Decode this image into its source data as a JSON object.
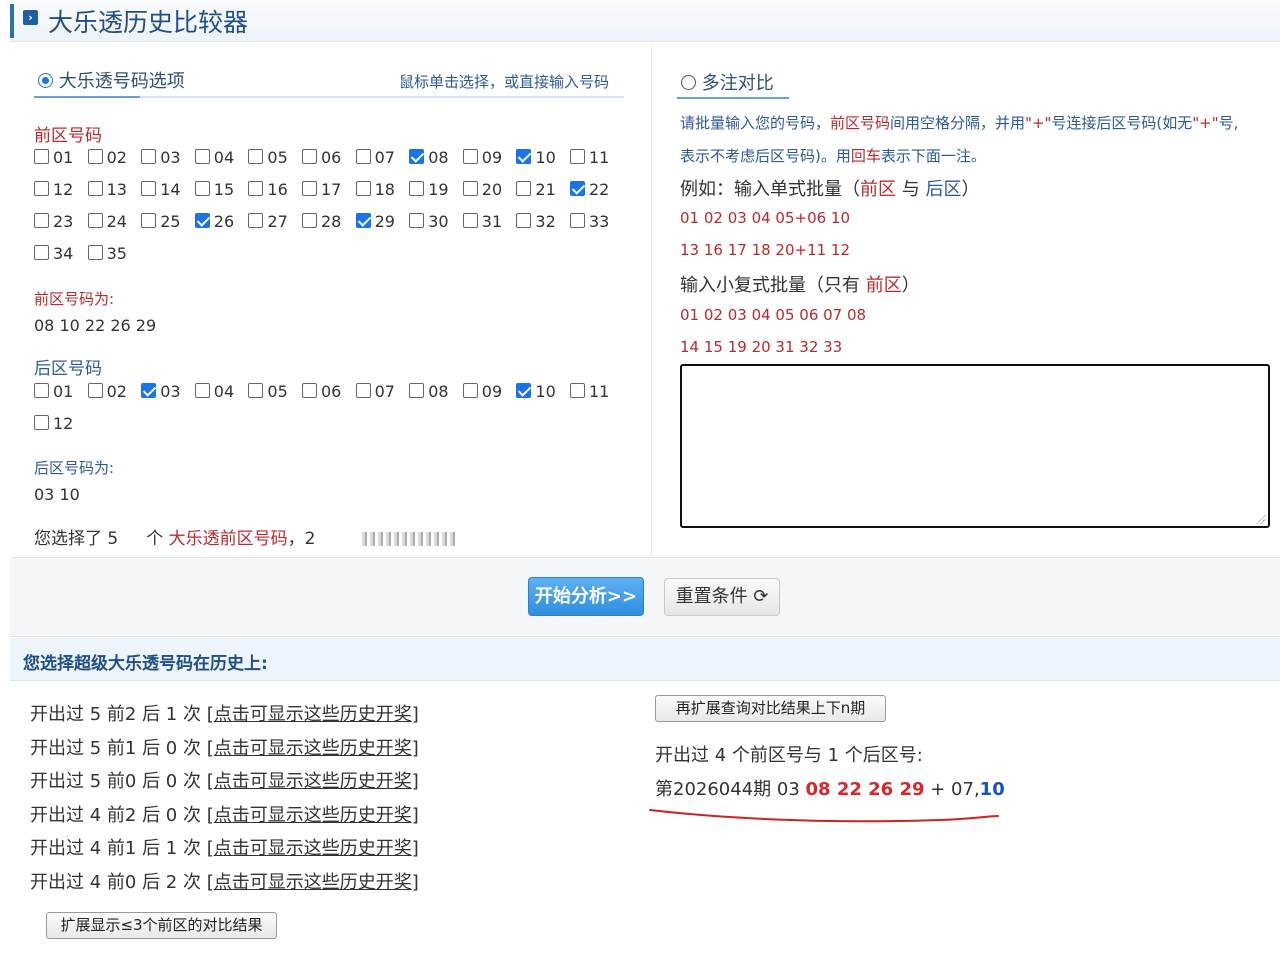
{
  "title": "大乐透历史比较器",
  "left": {
    "heading": "大乐透号码选项",
    "hint": "鼠标单击选择，或直接输入号码",
    "front_label": "前区号码",
    "front_rows": [
      [
        {
          "n": "01",
          "c": false
        },
        {
          "n": "02",
          "c": false
        },
        {
          "n": "03",
          "c": false
        },
        {
          "n": "04",
          "c": false
        },
        {
          "n": "05",
          "c": false
        },
        {
          "n": "06",
          "c": false
        },
        {
          "n": "07",
          "c": false
        },
        {
          "n": "08",
          "c": true
        },
        {
          "n": "09",
          "c": false
        },
        {
          "n": "10",
          "c": true
        },
        {
          "n": "11",
          "c": false
        }
      ],
      [
        {
          "n": "12",
          "c": false
        },
        {
          "n": "13",
          "c": false
        },
        {
          "n": "14",
          "c": false
        },
        {
          "n": "15",
          "c": false
        },
        {
          "n": "16",
          "c": false
        },
        {
          "n": "17",
          "c": false
        },
        {
          "n": "18",
          "c": false
        },
        {
          "n": "19",
          "c": false
        },
        {
          "n": "20",
          "c": false
        },
        {
          "n": "21",
          "c": false
        },
        {
          "n": "22",
          "c": true
        }
      ],
      [
        {
          "n": "23",
          "c": false
        },
        {
          "n": "24",
          "c": false
        },
        {
          "n": "25",
          "c": false
        },
        {
          "n": "26",
          "c": true
        },
        {
          "n": "27",
          "c": false
        },
        {
          "n": "28",
          "c": false
        },
        {
          "n": "29",
          "c": true
        },
        {
          "n": "30",
          "c": false
        },
        {
          "n": "31",
          "c": false
        },
        {
          "n": "32",
          "c": false
        },
        {
          "n": "33",
          "c": false
        }
      ],
      [
        {
          "n": "34",
          "c": false
        },
        {
          "n": "35",
          "c": false
        }
      ]
    ],
    "front_selected_label": "前区号码为:",
    "front_selected": "08  10  22  26  29",
    "back_label": "后区号码",
    "back_rows": [
      [
        {
          "n": "01",
          "c": false
        },
        {
          "n": "02",
          "c": false
        },
        {
          "n": "03",
          "c": true
        },
        {
          "n": "04",
          "c": false
        },
        {
          "n": "05",
          "c": false
        },
        {
          "n": "06",
          "c": false
        },
        {
          "n": "07",
          "c": false
        },
        {
          "n": "08",
          "c": false
        },
        {
          "n": "09",
          "c": false
        },
        {
          "n": "10",
          "c": true
        },
        {
          "n": "11",
          "c": false
        }
      ],
      [
        {
          "n": "12",
          "c": false
        }
      ]
    ],
    "back_selected_label": "后区号码为:",
    "back_selected": "03  10",
    "summary_prefix": "您选择了 5",
    "summary_mid": "个",
    "summary_red": "大乐透前区号码",
    "summary_suffix": "，2"
  },
  "right": {
    "heading": "多注对比",
    "instr1_a": "请批量输入您的号码，",
    "instr1_b": "前区号码",
    "instr1_c": "间用空格分隔，并用",
    "instr1_d": "\"+\"",
    "instr1_e": "号连接后区号码(如无",
    "instr1_f": "\"+\"",
    "instr1_g": "号,",
    "instr2_a": "表示不考虑后区号码)。用",
    "instr2_b": "回车",
    "instr2_c": "表示下面一注。",
    "example1_a": "例如：输入单式批量（",
    "example1_b": "前区",
    "example1_c": " 与 ",
    "example1_d": "后区",
    "example1_e": "）",
    "ex_line1": "01 02 03 04 05+06 10",
    "ex_line2": "13 16 17 18 20+11 12",
    "example2_a": "输入小复式批量（只有 ",
    "example2_b": "前区",
    "example2_c": "）",
    "ex_line3": "01 02 03 04 05 06 07 08",
    "ex_line4": "14 15 19 20 31 32 33"
  },
  "buttons": {
    "analyze": "开始分析>>",
    "reset": "重置条件 ⟳"
  },
  "results": {
    "heading": "您选择超级大乐透号码在历史上:",
    "rows": [
      {
        "text": "开出过 5 前2 后 1 次",
        "link": "点击可显示这些历史开奖"
      },
      {
        "text": "开出过 5 前1 后 0 次",
        "link": "点击可显示这些历史开奖"
      },
      {
        "text": "开出过 5 前0 后 0 次",
        "link": "点击可显示这些历史开奖"
      },
      {
        "text": "开出过 4 前2 后 0 次",
        "link": "点击可显示这些历史开奖"
      },
      {
        "text": "开出过 4 前1 后 1 次",
        "link": "点击可显示这些历史开奖"
      },
      {
        "text": "开出过 4 前0 后 2 次",
        "link": "点击可显示这些历史开奖"
      }
    ],
    "expand_button": "扩展显示≤3个前区的对比结果",
    "expand_period_button": "再扩展查询对比结果上下n期",
    "detail_title": "开出过 4 个前区号与 1 个后区号:",
    "detail_prefix": "第2026044期 03 ",
    "detail_red": "08 22 26 29",
    "detail_mid": " + 07,",
    "detail_blue": "10"
  }
}
